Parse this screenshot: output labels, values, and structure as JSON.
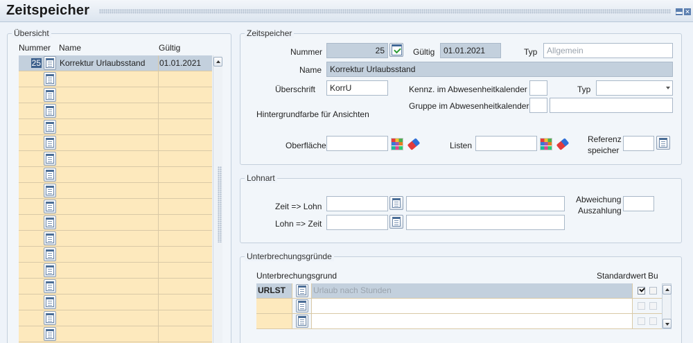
{
  "window": {
    "title": "Zeitspeicher",
    "minimize_glyph": "▬",
    "close_glyph": "✕"
  },
  "overview": {
    "legend": "Übersicht",
    "headers": {
      "number": "Nummer",
      "name": "Name",
      "valid": "Gültig"
    },
    "rows": [
      {
        "number": "25",
        "name": "Korrektur Urlaubsstand",
        "valid": "01.01.2021"
      },
      {
        "number": "",
        "name": "",
        "valid": ""
      },
      {
        "number": "",
        "name": "",
        "valid": ""
      },
      {
        "number": "",
        "name": "",
        "valid": ""
      },
      {
        "number": "",
        "name": "",
        "valid": ""
      },
      {
        "number": "",
        "name": "",
        "valid": ""
      },
      {
        "number": "",
        "name": "",
        "valid": ""
      },
      {
        "number": "",
        "name": "",
        "valid": ""
      },
      {
        "number": "",
        "name": "",
        "valid": ""
      },
      {
        "number": "",
        "name": "",
        "valid": ""
      },
      {
        "number": "",
        "name": "",
        "valid": ""
      },
      {
        "number": "",
        "name": "",
        "valid": ""
      },
      {
        "number": "",
        "name": "",
        "valid": ""
      },
      {
        "number": "",
        "name": "",
        "valid": ""
      },
      {
        "number": "",
        "name": "",
        "valid": ""
      },
      {
        "number": "",
        "name": "",
        "valid": ""
      },
      {
        "number": "",
        "name": "",
        "valid": ""
      },
      {
        "number": "",
        "name": "",
        "valid": ""
      },
      {
        "number": "",
        "name": "",
        "valid": ""
      }
    ]
  },
  "zeitspeicher": {
    "legend": "Zeitspeicher",
    "nummer_label": "Nummer",
    "nummer_value": "25",
    "gueltig_label": "Gültig",
    "gueltig_value": "01.01.2021",
    "typ_label": "Typ",
    "typ_value": "Allgemein",
    "name_label": "Name",
    "name_value": "Korrektur Urlaubsstand",
    "ueberschrift_label": "Überschrift",
    "ueberschrift_value": "KorrU",
    "kennz_label": "Kennz. im Abwesenheitkalender",
    "kennz_value": "",
    "typ2_label": "Typ",
    "typ2_value": "",
    "gruppe_label": "Gruppe im Abwesenheitkalender",
    "gruppe_code": "",
    "gruppe_value": "",
    "hintergrund_label": "Hintergrundfarbe für Ansichten",
    "oberflaeche_label": "Oberfläche",
    "oberflaeche_value": "",
    "listen_label": "Listen",
    "listen_value": "",
    "referenz_label_1": "Referenz",
    "referenz_label_2": "speicher",
    "referenz_value": ""
  },
  "lohnart": {
    "legend": "Lohnart",
    "zeit_lohn_label": "Zeit => Lohn",
    "zeit_lohn_code": "",
    "zeit_lohn_value": "",
    "lohn_zeit_label": "Lohn => Zeit",
    "lohn_zeit_code": "",
    "lohn_zeit_value": "",
    "abweichung_label_1": "Abweichung",
    "abweichung_label_2": "Auszahlung",
    "abweichung_value": ""
  },
  "unterbrechung": {
    "legend": "Unterbrechungsgründe",
    "col_reason": "Unterbrechungsgrund",
    "col_default": "Standardwert",
    "col_bu": "Bu",
    "rows": [
      {
        "code": "URLST",
        "desc": "Urlaub nach Stunden",
        "default": true,
        "bu": false
      },
      {
        "code": "",
        "desc": "",
        "default": false,
        "bu": false
      },
      {
        "code": "",
        "desc": "",
        "default": false,
        "bu": false
      }
    ]
  },
  "colors": {
    "row_yellow": "#fde9bd",
    "selected": "#c3d0dd",
    "accent": "#3b5f8c"
  }
}
